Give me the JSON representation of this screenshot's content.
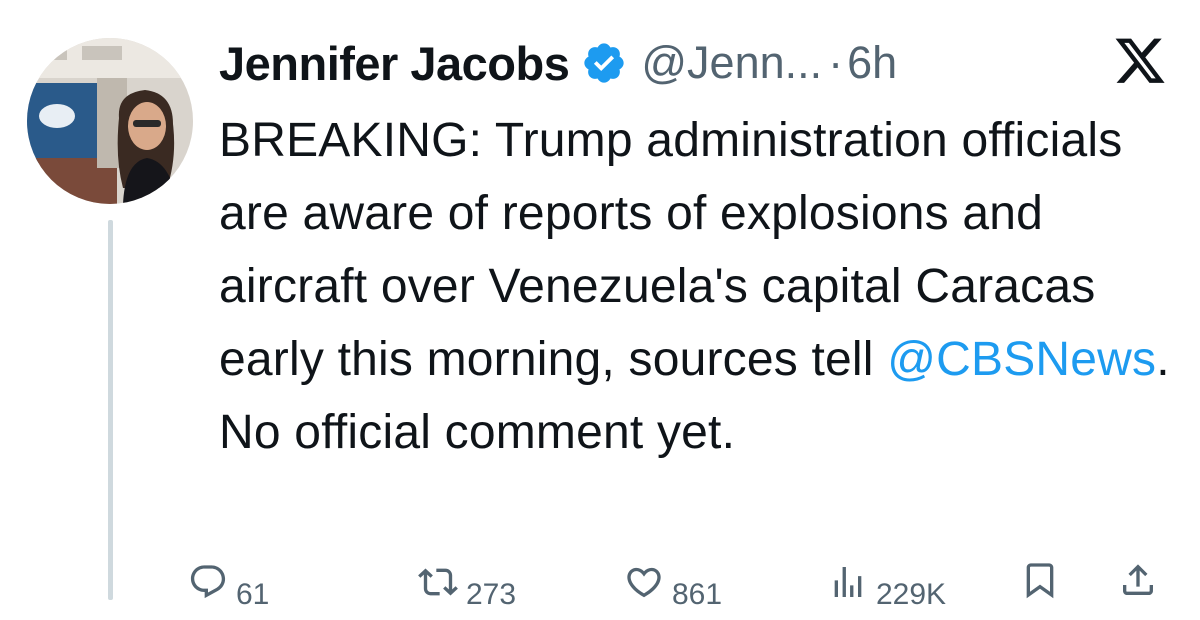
{
  "tweet": {
    "author": {
      "display_name": "Jennifer Jacobs",
      "handle": "@Jenn...",
      "verified": true
    },
    "separator": "·",
    "timestamp": "6h",
    "text_before_mention": "BREAKING: Trump administration officials are aware of reports of explosions and aircraft over Venezuela's capital Caracas early this morning, sources tell ",
    "mention": "@CBSNews",
    "text_after_mention": ". No official comment yet.",
    "actions": {
      "replies": "61",
      "reposts": "273",
      "likes": "861",
      "views": "229K"
    }
  },
  "icons": {
    "verified": "verified-badge-icon",
    "platform_logo": "x-logo-icon",
    "reply": "reply-icon",
    "repost": "repost-icon",
    "like": "heart-icon",
    "views": "views-chart-icon",
    "bookmark": "bookmark-icon",
    "share": "share-icon"
  },
  "colors": {
    "text": "#0f1419",
    "secondary": "#536471",
    "link": "#1d9bf0",
    "verified": "#1d9bf0",
    "thread_line": "#cfd9de"
  }
}
